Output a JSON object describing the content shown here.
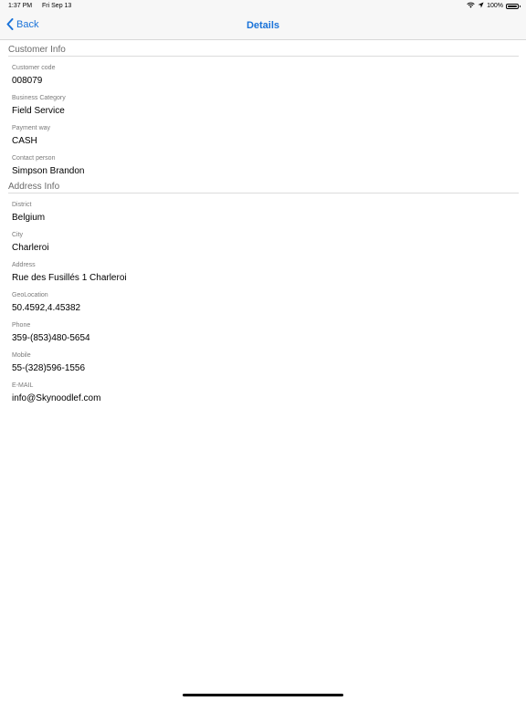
{
  "status_bar": {
    "time": "1:37 PM",
    "date": "Fri Sep 13",
    "battery": "100%",
    "wifi_icon": "wifi-icon",
    "location_icon": "location-arrow-icon"
  },
  "nav": {
    "back_label": "Back",
    "title": "Details",
    "accent_color": "#1a73d9"
  },
  "customer_info": {
    "header": "Customer Info",
    "fields": [
      {
        "label": "Customer code",
        "value": "008079"
      },
      {
        "label": "Business Category",
        "value": "Field Service"
      },
      {
        "label": "Payment way",
        "value": "CASH"
      },
      {
        "label": "Contact person",
        "value": "Simpson Brandon"
      }
    ]
  },
  "address_info": {
    "header": "Address Info",
    "fields": [
      {
        "label": "District",
        "value": "Belgium"
      },
      {
        "label": "City",
        "value": "Charleroi"
      },
      {
        "label": "Address",
        "value": "Rue des Fusillés 1 Charleroi"
      },
      {
        "label": "GeoLocation",
        "value": "50.4592,4.45382"
      },
      {
        "label": "Phone",
        "value": "359-(853)480-5654"
      },
      {
        "label": "Mobile",
        "value": "55-(328)596-1556"
      },
      {
        "label": "E-MAIL",
        "value": "info@Skynoodlef.com"
      }
    ]
  }
}
